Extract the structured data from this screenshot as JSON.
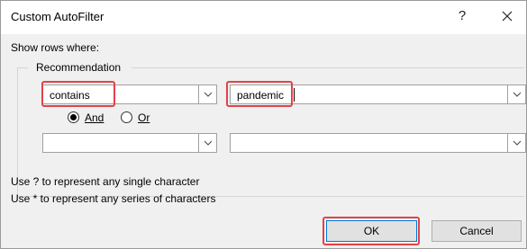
{
  "title": "Custom AutoFilter",
  "title_buttons": {
    "help": "?",
    "close_icon": "close-icon"
  },
  "show_rows_label": "Show rows where:",
  "field_name": "Recommendation",
  "criteria1": {
    "operator": "contains",
    "value": "pandemic"
  },
  "logic": {
    "and_label": "And",
    "or_label": "Or",
    "selected": "And"
  },
  "criteria2": {
    "operator": "",
    "value": ""
  },
  "hints": [
    "Use ? to represent any single character",
    "Use * to represent any series of characters"
  ],
  "buttons": {
    "ok": "OK",
    "cancel": "Cancel"
  },
  "colors": {
    "highlight": "#e0434a",
    "dialog_bg": "#f0f0f0",
    "default_button_border": "#0078d7"
  }
}
